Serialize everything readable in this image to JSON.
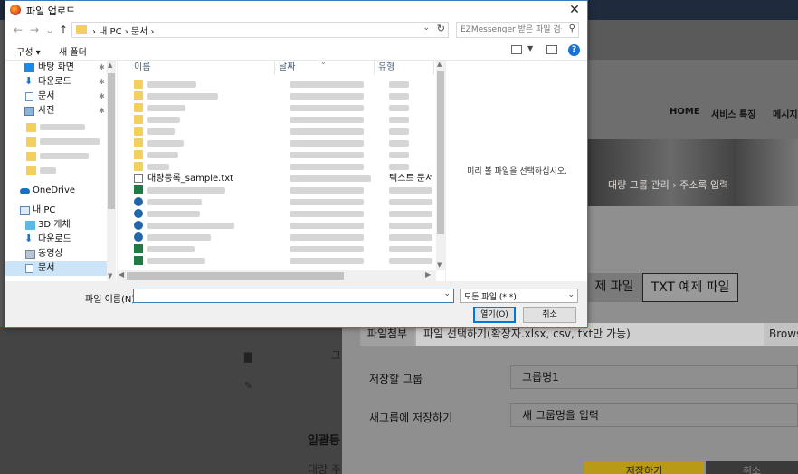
{
  "dialog": {
    "title": "파일 업로드",
    "close_glyph": "✕",
    "nav": {
      "back": "←",
      "forward": "→",
      "recent": "⌄",
      "up": "↑"
    },
    "address": {
      "crumbs": "›  내 PC  ›  문서  ›",
      "dropdown": "⌄",
      "refresh": "↻"
    },
    "search": {
      "placeholder": "EZMessenger 받은 파일 검색",
      "icon": "⚲"
    },
    "toolbar": {
      "organize": "구성 ▾",
      "new_folder": "새 폴더",
      "help": "?"
    },
    "sidebar": {
      "items": [
        {
          "label": "바탕 화면",
          "icon": "desktop-icon",
          "pinned": true
        },
        {
          "label": "다운로드",
          "icon": "download-icon",
          "pinned": true
        },
        {
          "label": "문서",
          "icon": "document-icon",
          "pinned": true
        },
        {
          "label": "사진",
          "icon": "pictures-icon",
          "pinned": true
        },
        {
          "label": "OneDrive",
          "icon": "onedrive-icon"
        },
        {
          "label": "내 PC",
          "icon": "pc-icon"
        },
        {
          "label": "3D 개체",
          "icon": "3d-objects-icon"
        },
        {
          "label": "다운로드",
          "icon": "download-icon"
        },
        {
          "label": "동영상",
          "icon": "video-icon"
        },
        {
          "label": "문서",
          "icon": "document-icon",
          "selected": true
        }
      ],
      "pin_glyph": "📌"
    },
    "columns": {
      "name": "이름",
      "date": "날짜",
      "type": "유형"
    },
    "files": [
      {
        "kind": "folder"
      },
      {
        "kind": "folder"
      },
      {
        "kind": "folder"
      },
      {
        "kind": "folder"
      },
      {
        "kind": "folder"
      },
      {
        "kind": "folder"
      },
      {
        "kind": "folder"
      },
      {
        "kind": "folder"
      },
      {
        "kind": "txt",
        "name": "대량등록_sample.txt",
        "type": "텍스트 문서"
      },
      {
        "kind": "xls"
      },
      {
        "kind": "ez"
      },
      {
        "kind": "ez"
      },
      {
        "kind": "ez"
      },
      {
        "kind": "ez"
      },
      {
        "kind": "xls"
      },
      {
        "kind": "xls"
      }
    ],
    "preview_message": "미리 볼 파일을 선택하십시오.",
    "filename_label": "파일 이름(N):",
    "filename_value": "",
    "filter_value": "모든 파일 (*.*)",
    "open_button": "열기(O)",
    "cancel_button": "취소"
  },
  "background": {
    "nav_items": [
      "HOME",
      "서비스 특징",
      "메시지"
    ],
    "banner_text": "대량 그룹 관리 › 주소록 입력",
    "tabs": [
      "제 파일",
      "TXT 예제 파일"
    ],
    "file_attach_label": "파일첨부",
    "file_attach_placeholder": "파일 선택하기(확장자.xlsx, csv, txt만 가능)",
    "browse": "Brows",
    "save_group_label": "저장할 그룹",
    "save_group_value": "그룹명1",
    "new_group_label": "새그룹에 저장하기",
    "new_group_placeholder": "새 그룹명을 입력",
    "left_heading": "일괄등",
    "left_text": "대량 주",
    "left_g": "그",
    "save_button": "저장하기",
    "cancel_button": "취소"
  }
}
